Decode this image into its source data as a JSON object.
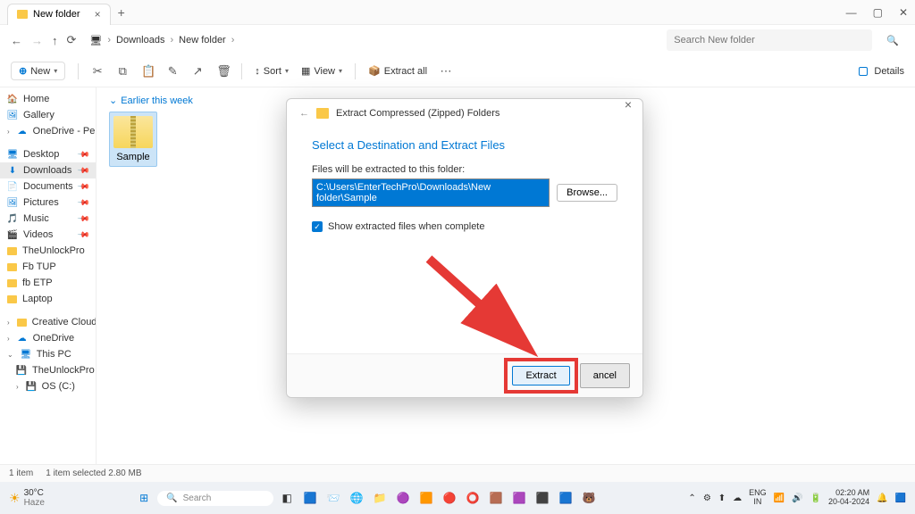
{
  "titlebar": {
    "tab_title": "New folder"
  },
  "nav": {
    "breadcrumb": [
      "Downloads",
      "New folder"
    ],
    "search_placeholder": "Search New folder"
  },
  "toolbar": {
    "new": "New",
    "sort": "Sort",
    "view": "View",
    "extract_all": "Extract all",
    "details": "Details"
  },
  "sidebar": {
    "home": "Home",
    "gallery": "Gallery",
    "onedrive": "OneDrive - Perso",
    "desktop": "Desktop",
    "downloads": "Downloads",
    "documents": "Documents",
    "pictures": "Pictures",
    "music": "Music",
    "videos": "Videos",
    "theunlockpro": "TheUnlockPro",
    "fb_tup": "Fb TUP",
    "fb_etp": "fb ETP",
    "laptop": "Laptop",
    "creative": "Creative Cloud Fi",
    "onedrive2": "OneDrive",
    "thispc": "This PC",
    "theunlockpro2": "TheUnlockPro",
    "osc": "OS (C:)"
  },
  "content": {
    "group": "Earlier this week",
    "file_name": "Sample"
  },
  "status": {
    "items": "1 item",
    "selected": "1 item selected  2.80 MB"
  },
  "dialog": {
    "title": "Extract Compressed (Zipped) Folders",
    "heading": "Select a Destination and Extract Files",
    "label": "Files will be extracted to this folder:",
    "path": "C:\\Users\\EnterTechPro\\Downloads\\New folder\\Sample",
    "browse": "Browse...",
    "checkbox": "Show extracted files when complete",
    "extract": "Extract",
    "cancel": "ancel"
  },
  "taskbar": {
    "temp": "30°C",
    "cond": "Haze",
    "search": "Search",
    "lang": "ENG",
    "region": "IN",
    "time": "02:20 AM",
    "date": "20-04-2024"
  }
}
